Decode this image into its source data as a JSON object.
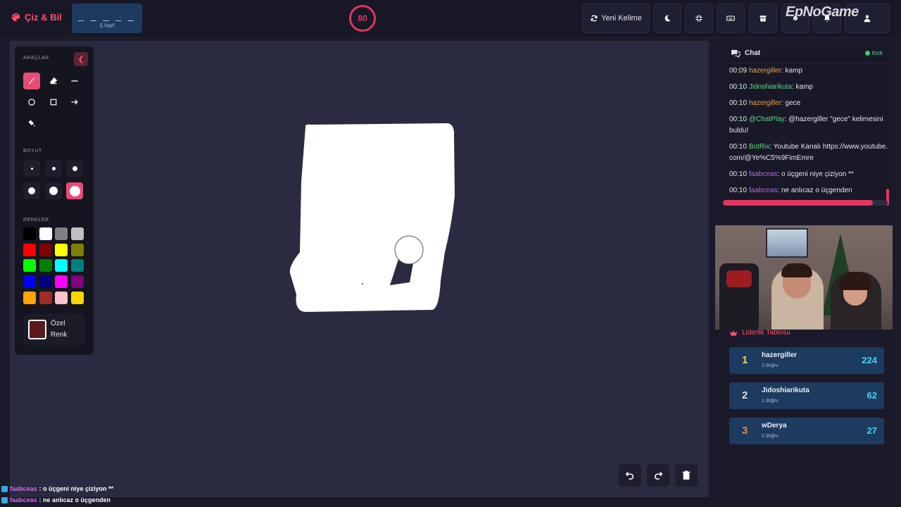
{
  "header": {
    "app_name": "Çiz & Bil",
    "word_mask": "_ _ _ _ _",
    "word_hint": "5 harf",
    "timer": "80",
    "new_word_label": "Yeni Kelime"
  },
  "watermark": "EpNoGame",
  "tools": {
    "tools_title": "ARAÇLAR",
    "size_title": "BOYUT",
    "colors_title": "RENKLER",
    "custom_color_label": "Özel Renk",
    "custom_color": "#5a1a1e",
    "active_tool": "brush",
    "active_size": 6,
    "brush_sizes": [
      1,
      2,
      3,
      4,
      5,
      6
    ],
    "palette": [
      "#000000",
      "#ffffff",
      "#808080",
      "#c0c0c0",
      "#ff0000",
      "#800000",
      "#ffff00",
      "#808000",
      "#00ff00",
      "#008000",
      "#00ffff",
      "#008080",
      "#0000ff",
      "#000080",
      "#ff00ff",
      "#800080",
      "#ffa500",
      "#a52a2a",
      "#ffc0cb",
      "#ffd700"
    ],
    "accent": "#e84c72"
  },
  "chat": {
    "title": "Chat",
    "platform": "Kick",
    "messages": [
      {
        "time": "00:09",
        "user": "hazergiller",
        "color": "#f0a03c",
        "text": ": kamp"
      },
      {
        "time": "00:10",
        "user": "Jidoshiarikuta",
        "color": "#5ddb7f",
        "text": ": kamp"
      },
      {
        "time": "00:10",
        "user": "hazergiller",
        "color": "#f0a03c",
        "text": ": gece"
      },
      {
        "time": "00:10",
        "user": "@ChatPlay",
        "color": "#5ddb7f",
        "text": ": @hazergiller \"gece\" kelimesini buldu!"
      },
      {
        "time": "00:10",
        "user": "BotRix",
        "color": "#5ddb7f",
        "text": ": Youtube Kanalı https://www.youtube.com/@Ye%C5%9FimEmre"
      },
      {
        "time": "00:10",
        "user": "faabceas",
        "color": "#b069e8",
        "text": ": o üçgeni niye çiziyon **"
      },
      {
        "time": "00:10",
        "user": "faabceas",
        "color": "#b069e8",
        "text": ": ne anlıcaz o üçgenden"
      }
    ],
    "progress": 0.91
  },
  "leaderboard": {
    "title": "Liderlik Tablosu",
    "rows": [
      {
        "rank": "1",
        "name": "hazergiller",
        "sub": "3 doğru",
        "score": "224",
        "rank_color": "#f5d547"
      },
      {
        "rank": "2",
        "name": "Jidoshiarikuta",
        "sub": "1 doğru",
        "score": "62",
        "rank_color": "#d9dde6"
      },
      {
        "rank": "3",
        "name": "wDerya",
        "sub": "2 doğru",
        "score": "27",
        "rank_color": "#e08a3c"
      }
    ]
  },
  "overlay_chat": [
    {
      "user": "faabceas",
      "text": " : o üçgeni niye çiziyon **"
    },
    {
      "user": "faabceas",
      "text": " : ne anlıcaz o üçgenden"
    }
  ]
}
